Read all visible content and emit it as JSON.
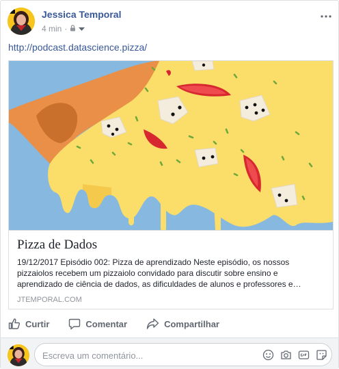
{
  "post": {
    "author": "Jessica Temporal",
    "timestamp": "4 min",
    "privacy_icon": "lock-icon",
    "link": "http://podcast.datascience.pizza/"
  },
  "preview": {
    "title": "Pizza de Dados",
    "description": "19/12/2017 Episódio 002: Pizza de aprendizado Neste episódio, os nossos pizzaiolos recebem um pizzaiolo convidado para discutir sobre ensino e aprendizado de ciência de dados, as dificuldades de alunos e professores e…",
    "domain": "JTEMPORAL.COM"
  },
  "actions": {
    "like": "Curtir",
    "comment": "Comentar",
    "share": "Compartilhar"
  },
  "comment_box": {
    "placeholder": "Escreva um comentário..."
  },
  "colors": {
    "link": "#385898",
    "muted": "#90949c",
    "sky": "#86b8e0",
    "cheese": "#fbdd69",
    "crust": "#e98f48"
  }
}
